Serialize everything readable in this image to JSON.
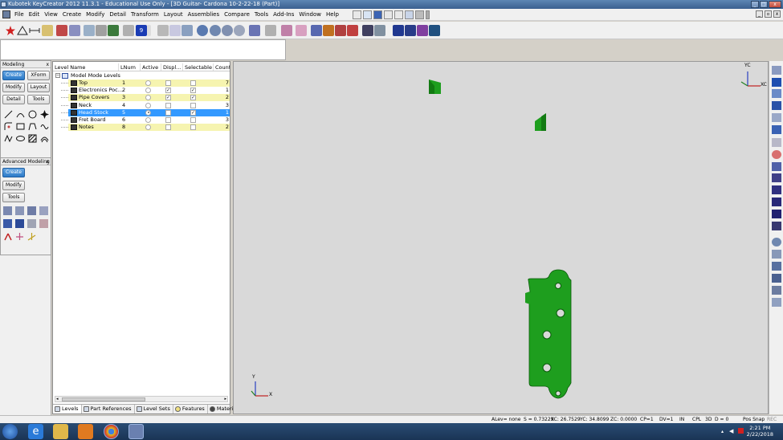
{
  "window": {
    "title": "Kubotek KeyCreator 2012 11.3.1 - Educational Use Only - [3D Guitar- Cardona 10-2-22-18 (Part)]",
    "minimize": "_",
    "maximize": "□",
    "close": "x"
  },
  "menubar": {
    "items": [
      {
        "label": "File"
      },
      {
        "label": "Edit"
      },
      {
        "label": "View"
      },
      {
        "label": "Create"
      },
      {
        "label": "Modify"
      },
      {
        "label": "Detail"
      },
      {
        "label": "Transform"
      },
      {
        "label": "Layout"
      },
      {
        "label": "Assemblies"
      },
      {
        "label": "Compare"
      },
      {
        "label": "Tools"
      },
      {
        "label": "Add-Ins"
      },
      {
        "label": "Window"
      },
      {
        "label": "Help"
      }
    ]
  },
  "toolbar": {
    "layer_value": "9"
  },
  "modeling_panel": {
    "title": "Modeling",
    "close": "x",
    "buttons": [
      "Create",
      "XForm",
      "Modify",
      "Layout",
      "Detail",
      "Tools"
    ]
  },
  "advanced_panel": {
    "title": "Advanced Modeling",
    "close": "x",
    "buttons": [
      "Create",
      "Modify",
      "Tools"
    ]
  },
  "levels": {
    "columns": [
      "Level Name",
      "LNum",
      "Active",
      "Displ...",
      "Selectable",
      "Count"
    ],
    "root": "Model Mode Levels",
    "rows": [
      {
        "name": "Top",
        "num": "1",
        "count": "7",
        "active": false,
        "display": false,
        "selectable": false,
        "highlight": "yellow"
      },
      {
        "name": "Electronics Poc...",
        "num": "2",
        "count": "1",
        "active": false,
        "display": true,
        "selectable": true,
        "highlight": "none"
      },
      {
        "name": "Pipe Covers",
        "num": "3",
        "count": "2",
        "active": false,
        "display": true,
        "selectable": true,
        "highlight": "yellow"
      },
      {
        "name": "Neck",
        "num": "4",
        "count": "3",
        "active": false,
        "display": false,
        "selectable": false,
        "highlight": "none"
      },
      {
        "name": "Head Stock",
        "num": "5",
        "count": "1",
        "active": true,
        "display": false,
        "selectable": true,
        "highlight": "selected"
      },
      {
        "name": "Fret Board",
        "num": "6",
        "count": "3",
        "active": false,
        "display": false,
        "selectable": false,
        "highlight": "none"
      },
      {
        "name": "Notes",
        "num": "8",
        "count": "2",
        "active": false,
        "display": false,
        "selectable": false,
        "highlight": "yellow"
      }
    ],
    "tabs": [
      "Levels",
      "Part References",
      "Level Sets",
      "Features",
      "Materials"
    ]
  },
  "viewport": {
    "triad_top_y": "YC",
    "triad_top_x": "XC",
    "triad_bottom_y": "Y",
    "triad_bottom_x": "X"
  },
  "statusbar": {
    "alev": "ALev= none",
    "scale": "S = 0.73229",
    "xc": "XC: 26.7529",
    "yc": "YC: 34.8099",
    "zc": "ZC: 0.0000",
    "cp": "CP=1",
    "dv": "DV=1",
    "units": "IN",
    "cpl": "CPL",
    "d3": "3D",
    "d": "D = 0",
    "possnap": "Pos Snap",
    "rec": "REC"
  },
  "taskbar": {
    "time": "2:21 PM",
    "date": "2/22/2018"
  },
  "colors": {
    "part_green": "#1e9e1e",
    "selection_blue": "#3399ff",
    "level_yellow": "#f6f4b0",
    "viewport_bg": "#d9d9d9"
  }
}
